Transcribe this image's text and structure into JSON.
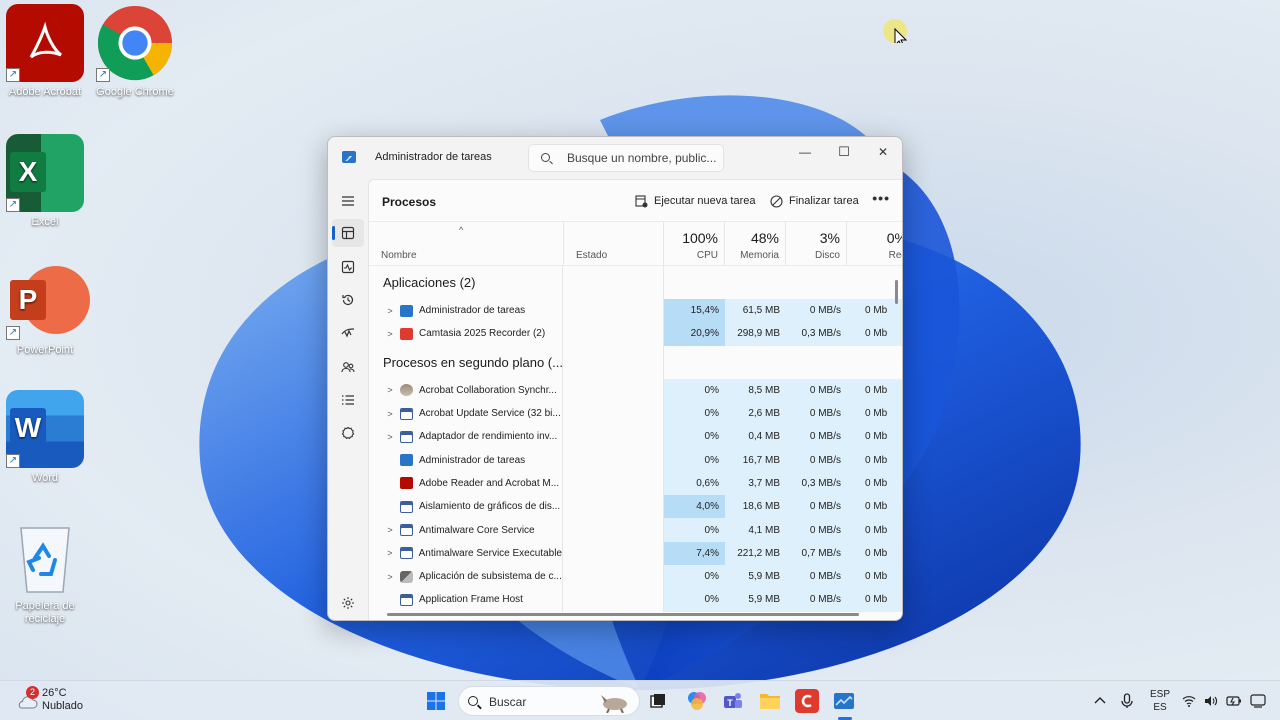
{
  "desktop": {
    "icons": [
      {
        "label": "Adobe Acrobat",
        "icon": "acrobat-icon",
        "color": "#b30b00"
      },
      {
        "label": "Google Chrome",
        "icon": "chrome-icon",
        "color": "#4285f4"
      },
      {
        "label": "Excel",
        "icon": "excel-icon",
        "color": "#107c41"
      },
      {
        "label": "PowerPoint",
        "icon": "powerpoint-icon",
        "color": "#c43e1c"
      },
      {
        "label": "Word",
        "icon": "word-icon",
        "color": "#185abd"
      },
      {
        "label": "Papelera de reciclaje",
        "icon": "recycle-bin-icon",
        "color": "#1e88e5"
      }
    ]
  },
  "window": {
    "title": "Administrador de tareas",
    "search_placeholder": "Busque un nombre, public...",
    "controls": {
      "minimize": "—",
      "maximize": "☐",
      "close": "✕"
    }
  },
  "sidebar": {
    "items": [
      "menu-icon",
      "processes-icon",
      "performance-icon",
      "app-history-icon",
      "startup-apps-icon",
      "users-icon",
      "details-icon",
      "services-icon",
      "settings-icon"
    ],
    "active": "processes-icon"
  },
  "toolbar": {
    "page_title": "Procesos",
    "run_task_label": "Ejecutar nueva tarea",
    "end_task_label": "Finalizar tarea",
    "more_label": "•••"
  },
  "columns": {
    "name": "Nombre",
    "status": "Estado",
    "cpu": {
      "pct": "100%",
      "label": "CPU"
    },
    "memory": {
      "pct": "48%",
      "label": "Memoria"
    },
    "disk": {
      "pct": "3%",
      "label": "Disco"
    },
    "network": {
      "pct": "0%",
      "label": "Red"
    }
  },
  "groups": [
    {
      "title": "Aplicaciones (2)",
      "rows": [
        {
          "expand": true,
          "name": "Administrador de tareas",
          "icon": "taskmgr-icon",
          "cpu": "15,4%",
          "mem": "61,5 MB",
          "disk": "0 MB/s",
          "net": "0 Mb",
          "heat": "#b7dcf6"
        },
        {
          "expand": true,
          "name": "Camtasia 2025 Recorder (2)",
          "icon": "camtasia-icon",
          "cpu": "20,9%",
          "mem": "298,9 MB",
          "disk": "0,3 MB/s",
          "net": "0 Mb",
          "heat": "#b7dcf6"
        }
      ]
    },
    {
      "title": "Procesos en segundo plano (...",
      "rows": [
        {
          "expand": true,
          "name": "Acrobat Collaboration Synchr...",
          "icon": "acrobat-sync-icon",
          "cpu": "0%",
          "mem": "8,5 MB",
          "disk": "0 MB/s",
          "net": "0 Mb",
          "heat": "#def0fc"
        },
        {
          "expand": true,
          "name": "Acrobat Update Service (32 bi...",
          "icon": "window-icon",
          "cpu": "0%",
          "mem": "2,6 MB",
          "disk": "0 MB/s",
          "net": "0 Mb",
          "heat": "#def0fc"
        },
        {
          "expand": true,
          "name": "Adaptador de rendimiento inv...",
          "icon": "window-icon",
          "cpu": "0%",
          "mem": "0,4 MB",
          "disk": "0 MB/s",
          "net": "0 Mb",
          "heat": "#def0fc"
        },
        {
          "expand": false,
          "name": "Administrador de tareas",
          "icon": "taskmgr-icon",
          "cpu": "0%",
          "mem": "16,7 MB",
          "disk": "0 MB/s",
          "net": "0 Mb",
          "heat": "#def0fc"
        },
        {
          "expand": false,
          "name": "Adobe Reader and Acrobat M...",
          "icon": "acrobat-icon",
          "cpu": "0,6%",
          "mem": "3,7 MB",
          "disk": "0,3 MB/s",
          "net": "0 Mb",
          "heat": "#def0fc"
        },
        {
          "expand": false,
          "name": "Aislamiento de gráficos de dis...",
          "icon": "window-icon",
          "cpu": "4,0%",
          "mem": "18,6 MB",
          "disk": "0 MB/s",
          "net": "0 Mb",
          "heat": "#b7dcf6"
        },
        {
          "expand": true,
          "name": "Antimalware Core Service",
          "icon": "window-icon",
          "cpu": "0%",
          "mem": "4,1 MB",
          "disk": "0 MB/s",
          "net": "0 Mb",
          "heat": "#def0fc"
        },
        {
          "expand": true,
          "name": "Antimalware Service Executable",
          "icon": "window-icon",
          "cpu": "7,4%",
          "mem": "221,2 MB",
          "disk": "0,7 MB/s",
          "net": "0 Mb",
          "heat": "#b7dcf6"
        },
        {
          "expand": true,
          "name": "Aplicación de subsistema de c...",
          "icon": "subsystem-icon",
          "cpu": "0%",
          "mem": "5,9 MB",
          "disk": "0 MB/s",
          "net": "0 Mb",
          "heat": "#def0fc"
        },
        {
          "expand": false,
          "name": "Application Frame Host",
          "icon": "window-icon",
          "cpu": "0%",
          "mem": "5,9 MB",
          "disk": "0 MB/s",
          "net": "0 Mb",
          "heat": "#def0fc"
        }
      ]
    }
  ],
  "taskbar": {
    "weather_temp": "26°C",
    "weather_desc": "Nublado",
    "weather_badge": "2",
    "search_label": "Buscar",
    "pinned": [
      "start-icon",
      "search-icon",
      "taskview-icon",
      "copilot-icon",
      "teams-icon",
      "file-explorer-icon",
      "camtasia-icon",
      "taskmgr-icon"
    ],
    "lang_top": "ESP",
    "lang_bottom": "ES"
  }
}
